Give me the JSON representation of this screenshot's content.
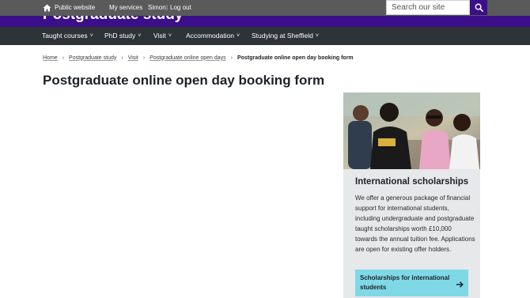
{
  "topbar": {
    "public_website": "Public website",
    "my_services": "My services",
    "user_name": "Simon",
    "separator": "|",
    "log_out": "Log out"
  },
  "site": {
    "title": "Postgraduate study"
  },
  "search": {
    "placeholder": "Search our site"
  },
  "nav": {
    "items": [
      {
        "label": "Taught courses"
      },
      {
        "label": "PhD study"
      },
      {
        "label": "Visit"
      },
      {
        "label": "Accommodation"
      },
      {
        "label": "Studying at Sheffield"
      }
    ]
  },
  "breadcrumb": {
    "items": [
      {
        "label": "Home"
      },
      {
        "label": "Postgraduate study"
      },
      {
        "label": "Visit"
      },
      {
        "label": "Postgraduate online open days"
      }
    ],
    "current": "Postgraduate online open day booking form"
  },
  "page": {
    "title": "Postgraduate online open day booking form"
  },
  "promo": {
    "title": "International scholarships",
    "text": "We offer a generous package of financial support for international students, including undergraduate and postgraduate taught scholarships worth £10,000 towards the annual tuition fee. Applications are open for existing offer holders.",
    "cta_label": "Scholarships for international students"
  },
  "colors": {
    "topbar": "#5a5a5a",
    "brand_purple": "#3b0f8a",
    "nav_bg": "#2e3338",
    "card_bg": "#e6e8ea",
    "cta_bg": "#7fd8e6"
  },
  "icons": {
    "home": "home-icon",
    "search": "search-icon",
    "chevron": "chevron-down-icon",
    "arrow": "arrow-right-icon"
  }
}
